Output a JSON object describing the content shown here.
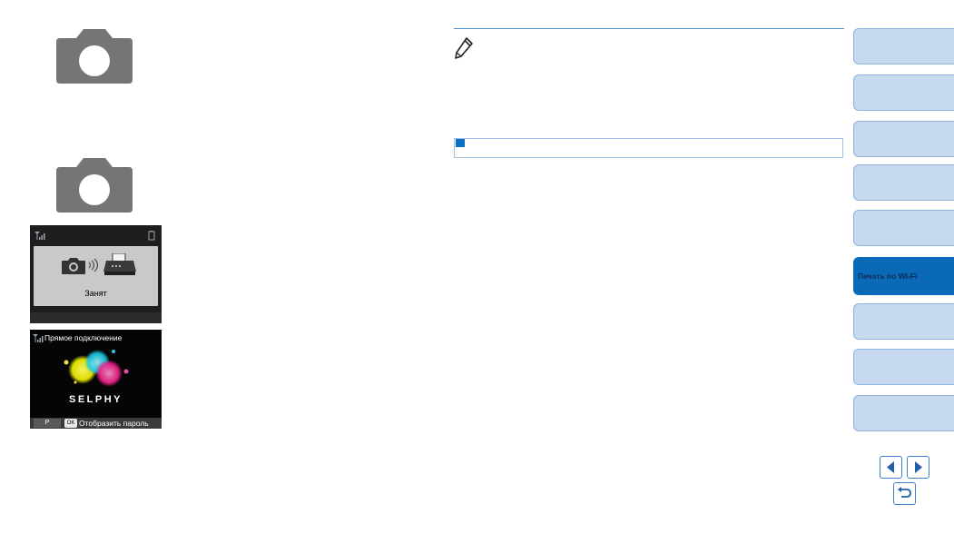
{
  "screens": {
    "busy": {
      "status_label": "Занят"
    },
    "direct": {
      "title": "Прямое подключение",
      "brand": "SELPHY",
      "p_key": "P",
      "ok_key": "OK",
      "show_password": "Отобразить пароль"
    }
  },
  "side_tabs": [
    {
      "label": ""
    },
    {
      "label": ""
    },
    {
      "label": ""
    },
    {
      "label": ""
    },
    {
      "label": ""
    },
    {
      "label": "Печать по Wi-Fi",
      "active": true
    },
    {
      "label": ""
    },
    {
      "label": ""
    },
    {
      "label": ""
    }
  ],
  "colors": {
    "accent": "#0a6ab8",
    "tab_bg": "#c7d9ef",
    "tab_border": "#8eb3de"
  },
  "icons": [
    "camera-icon",
    "pencil-note-icon",
    "wifi-signal-icon",
    "printer-icon",
    "prev-page-icon",
    "next-page-icon",
    "back-icon"
  ]
}
